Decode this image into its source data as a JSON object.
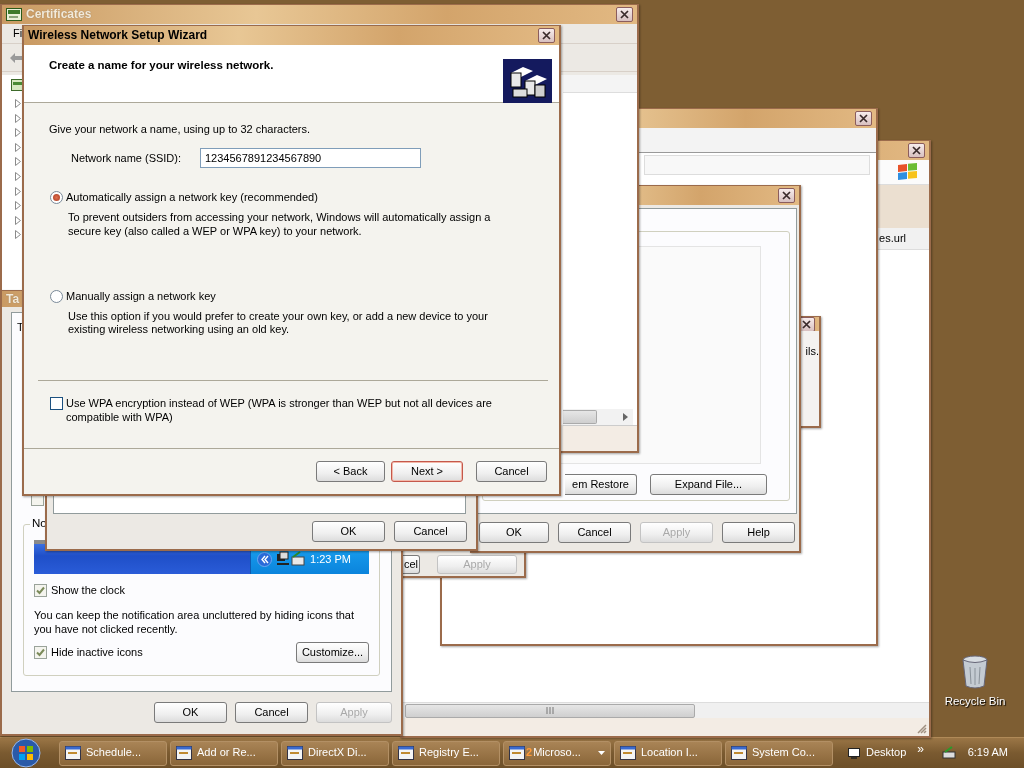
{
  "wide_window": {
    "list_item": "es.url"
  },
  "detail_window": {
    "text": "ils."
  },
  "apply_window": {
    "buttons": [
      {
        "label": "cel",
        "disabled": false
      },
      {
        "label": "Apply",
        "disabled": true
      }
    ]
  },
  "system_window": {
    "action_buttons": [
      "em Restore",
      "Expand File..."
    ],
    "buttons": [
      {
        "label": "OK",
        "disabled": false
      },
      {
        "label": "Cancel",
        "disabled": false
      },
      {
        "label": "Apply",
        "disabled": true
      },
      {
        "label": "Help",
        "disabled": false
      }
    ]
  },
  "certificates_window": {
    "title": "Certificates",
    "menu": [
      "Fi"
    ]
  },
  "taskbar_properties": {
    "title": "Ta",
    "tab_text": "T",
    "stray_checkbox": {
      "checked": false
    },
    "group_label": "No",
    "preview_clock": "1:23 PM",
    "options": [
      {
        "label": "Show the clock",
        "checked": true
      },
      {
        "label": "Hide inactive icons",
        "checked": true
      }
    ],
    "note": "You can keep the notification area uncluttered by hiding icons that you have not clicked recently.",
    "customize_button": "Customize...",
    "buttons": [
      {
        "label": "OK",
        "disabled": false
      },
      {
        "label": "Cancel",
        "disabled": false
      },
      {
        "label": "Apply",
        "disabled": true
      }
    ]
  },
  "confirm_dialog": {
    "buttons": [
      {
        "label": "OK",
        "disabled": false
      },
      {
        "label": "Cancel",
        "disabled": false
      }
    ]
  },
  "wizard": {
    "title": "Wireless Network Setup Wizard",
    "heading": "Create a name for your wireless network.",
    "intro": "Give your network a name, using up to 32 characters.",
    "ssid_label": "Network name (SSID):",
    "ssid_value": "1234567891234567890",
    "key_options": [
      {
        "label": "Automatically assign a network key (recommended)",
        "selected": true,
        "description": "To prevent outsiders from accessing your network, Windows will automatically assign a secure key (also called a WEP or WPA key) to your network."
      },
      {
        "label": "Manually assign a network key",
        "selected": false,
        "description": "Use this option if you would prefer to create your own key, or add a new device to your existing wireless networking using an old key."
      }
    ],
    "wpa_option": {
      "label": "Use WPA encryption instead of WEP (WPA is stronger than WEP but not all devices are compatible with WPA)",
      "checked": false
    },
    "buttons": [
      {
        "label": "< Back",
        "default": false
      },
      {
        "label": "Next >",
        "default": true
      },
      {
        "label": "Cancel",
        "default": false
      }
    ]
  },
  "desktop_icons": [
    {
      "label": "Recycle Bin"
    }
  ],
  "taskbar": {
    "buttons": [
      {
        "label": "Schedule...",
        "grouped": false
      },
      {
        "label": "Add or Re...",
        "grouped": false
      },
      {
        "label": "DirectX Di...",
        "grouped": false
      },
      {
        "label": "Registry E...",
        "grouped": false
      },
      {
        "label": "Microso...",
        "count": "2",
        "grouped": true
      },
      {
        "label": "Location I...",
        "grouped": false
      },
      {
        "label": "System Co...",
        "grouped": false
      }
    ],
    "toolbar_label": "Desktop",
    "overflow": "»",
    "clock": "6:19 AM"
  }
}
